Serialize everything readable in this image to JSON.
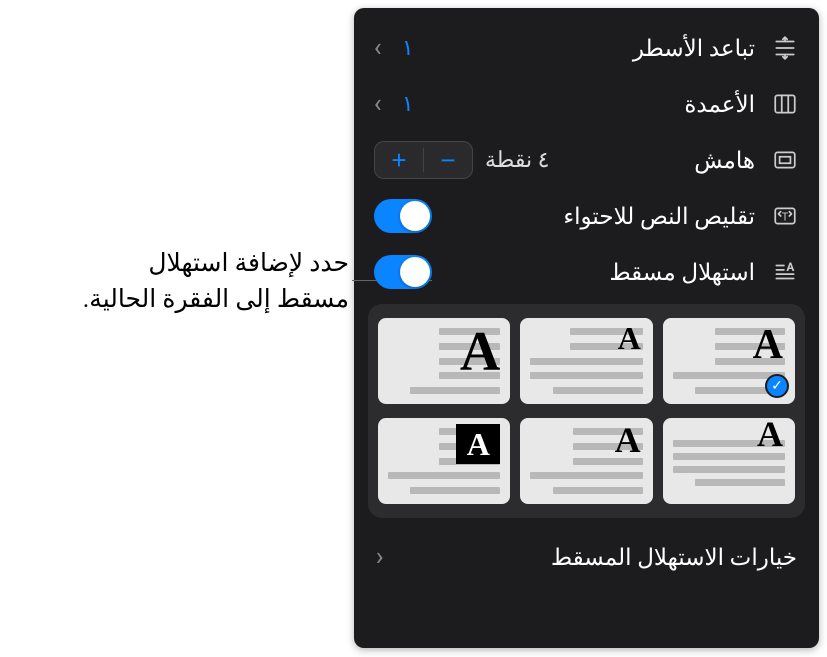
{
  "rows": {
    "lineSpacing": {
      "label": "تباعد الأسطر",
      "value": "١"
    },
    "columns": {
      "label": "الأعمدة",
      "value": "١"
    },
    "margin": {
      "label": "هامش",
      "value": "٤ نقطة"
    },
    "shrinkText": {
      "label": "تقليص النص للاحتواء",
      "on": true
    },
    "dropCap": {
      "label": "استهلال مسقط",
      "on": true
    }
  },
  "capLetter": "A",
  "selectedTile": 1,
  "optionsLabel": "خيارات الاستهلال المسقط",
  "callout": {
    "line1": "حدد لإضافة استهلال",
    "line2": "مسقط إلى الفقرة الحالية."
  },
  "icons": {
    "check": "✓"
  }
}
